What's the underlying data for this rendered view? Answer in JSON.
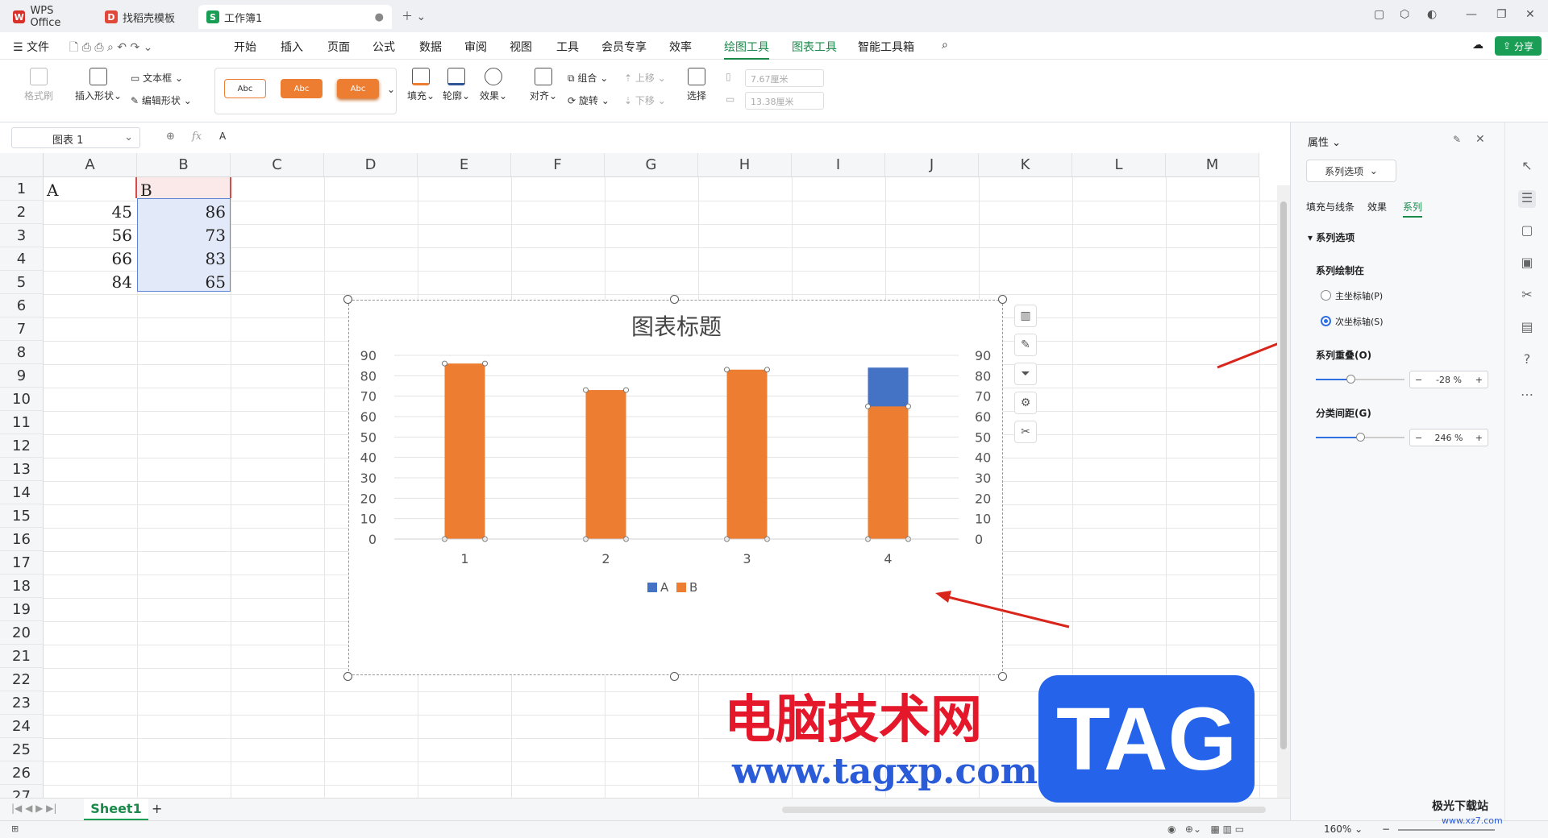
{
  "tabs": [
    {
      "label": "WPS Office",
      "color": "#d9302a"
    },
    {
      "label": "找稻壳模板",
      "color": "#e0483a"
    },
    {
      "label": "工作簿1",
      "color": "#1a9e55",
      "icon": "S"
    }
  ],
  "menu": {
    "file": "文件",
    "items": [
      "开始",
      "插入",
      "页面",
      "公式",
      "数据",
      "审阅",
      "视图",
      "工具",
      "会员专享",
      "效率"
    ],
    "drawing_tools": "绘图工具",
    "chart_tools": "图表工具",
    "smart_tools": "智能工具箱",
    "share": "分享"
  },
  "ribbon": {
    "format_painter": "格式刷",
    "insert_shape": "插入形状",
    "text_box": "文本框",
    "edit_shape": "编辑形状",
    "style_sample": "Abc",
    "fill": "填充",
    "outline": "轮廓",
    "effect": "效果",
    "align": "对齐",
    "group": "组合",
    "rotate": "旋转",
    "bring_forward": "上移",
    "send_backward": "下移",
    "select": "选择",
    "height": "7.67厘米",
    "width": "13.38厘米"
  },
  "formula": {
    "name_box": "图表 1",
    "fx": "fx",
    "content": "A"
  },
  "columns": [
    "A",
    "B",
    "C",
    "D",
    "E",
    "F",
    "G",
    "H",
    "I",
    "J",
    "K",
    "L",
    "M"
  ],
  "rows": [
    "1",
    "2",
    "3",
    "4",
    "5",
    "6",
    "7",
    "8",
    "9",
    "10",
    "11",
    "12",
    "13",
    "14",
    "15",
    "16",
    "17",
    "18",
    "19",
    "20",
    "21",
    "22",
    "23",
    "24",
    "25",
    "26",
    "27"
  ],
  "cells": {
    "headers": [
      "A",
      "B"
    ],
    "a": [
      "45",
      "56",
      "66",
      "84"
    ],
    "b": [
      "86",
      "73",
      "83",
      "65"
    ]
  },
  "chart_data": {
    "type": "bar",
    "title": "图表标题",
    "categories": [
      "1",
      "2",
      "3",
      "4"
    ],
    "series": [
      {
        "name": "A",
        "values": [
          45,
          56,
          66,
          84
        ],
        "color": "#4472c4",
        "axis": "secondary"
      },
      {
        "name": "B",
        "values": [
          86,
          73,
          83,
          65
        ],
        "color": "#ed7d31",
        "axis": "secondary"
      }
    ],
    "ylim": [
      0,
      90
    ],
    "yticks": [
      "0",
      "10",
      "20",
      "30",
      "40",
      "50",
      "60",
      "70",
      "80",
      "90"
    ],
    "legend": "bottom"
  },
  "sheet": {
    "name": "Sheet1",
    "add": "+"
  },
  "panel": {
    "title": "属性",
    "dropdown": "系列选项",
    "tabs": [
      "填充与线条",
      "效果",
      "系列"
    ],
    "section": "系列选项",
    "plot_on": "系列绘制在",
    "primary": "主坐标轴(P)",
    "secondary": "次坐标轴(S)",
    "overlap_label": "系列重叠(O)",
    "overlap_value": "-28",
    "gap_label": "分类间距(G)",
    "gap_value": "246",
    "unit": "%",
    "minus": "−",
    "plus": "+"
  },
  "status": {
    "zoom": "160%"
  },
  "watermark": {
    "cn": "电脑技术网",
    "url": "www.tagxp.com",
    "tag": "TAG",
    "brand": "极光下载站",
    "brand_url": "www.xz7.com"
  }
}
